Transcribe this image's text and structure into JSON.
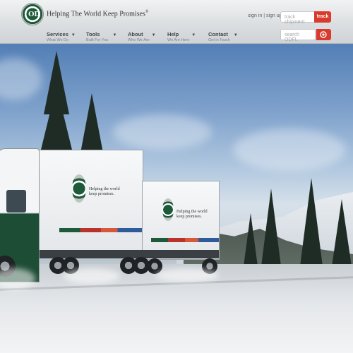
{
  "header": {
    "logo_letters": "OD",
    "tagline": "Helping The World Keep Promises",
    "tagline_mark": "®",
    "sign_in_label": "sign in",
    "separator": "|",
    "sign_up_label": "sign up",
    "track_placeholder": "track shipment",
    "track_button_label": "track",
    "search_placeholder": "search ODFL",
    "search_icon": "search-icon",
    "accent_color": "#d83a2b"
  },
  "nav": {
    "items": [
      {
        "label": "Services",
        "sub": "What We Do"
      },
      {
        "label": "Tools",
        "sub": "Built For You"
      },
      {
        "label": "About",
        "sub": "Who We Are"
      },
      {
        "label": "Help",
        "sub": "We Are Here"
      },
      {
        "label": "Contact",
        "sub": "Get in Touch"
      }
    ],
    "caret_icon": "chevron-down-icon"
  },
  "hero": {
    "trailer_tagline_line1": "Helping the world",
    "trailer_tagline_line2": "keep promises.",
    "brand_green": "#1d5a3a"
  }
}
